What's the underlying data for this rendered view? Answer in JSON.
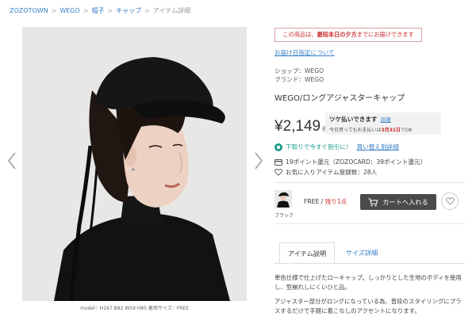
{
  "breadcrumb": {
    "items": [
      "ZOZOTOWN",
      "WEGO",
      "帽子",
      "キャップ"
    ],
    "current": "アイテム詳細",
    "separator": ">"
  },
  "gallery": {
    "caption": "model：H167 B82 W59 H85 着用サイズ：FREE"
  },
  "delivery": {
    "notice_prefix": "この商品は、",
    "notice_emphasis": "最短本日の夕方",
    "notice_suffix": "までにお届けできます",
    "date_link": "お届け日指定について"
  },
  "product": {
    "shop_label": "ショップ：WEGO",
    "brand_label": "ブランド：WEGO",
    "title": "WEGO/ロングアジャスターキャップ",
    "price": "¥2,149",
    "tax_note": "税込"
  },
  "deferred_payment": {
    "title": "ツケ払いできます",
    "detail_link": "詳細",
    "note_prefix": "今日買ってもお支払いは",
    "note_date": "3月31日",
    "note_suffix": "でOK"
  },
  "sell": {
    "text": "下取りで今すぐ割引に！",
    "link": "買い替え割詳細"
  },
  "points": {
    "text": "19ポイント還元（ZOZOCARD：39ポイント還元）"
  },
  "favorites": {
    "text": "お気に入りアイテム登録数：28人"
  },
  "variant": {
    "color_name": "ブラック",
    "size": "FREE",
    "size_separator": "/",
    "stock": "残り1点",
    "cart_button": "カートへ入れる"
  },
  "tabs": [
    {
      "label": "アイテム説明",
      "active": true
    },
    {
      "label": "サイズ詳細",
      "active": false
    }
  ],
  "description": [
    "単色仕様で仕上げたローキャップ。しっかりとした生地のボディを使用し、型崩れしにくいひと品。",
    "アジャスター部分がロングになっている為、普段のスタイリングにプラスするだけで手軽に着こなしのアクセントになります。"
  ],
  "colors": {
    "link": "#3a7fc8",
    "alert": "#cc2f2f",
    "teal": "#1e9b8e",
    "cart_bg": "#4a4a4a"
  }
}
